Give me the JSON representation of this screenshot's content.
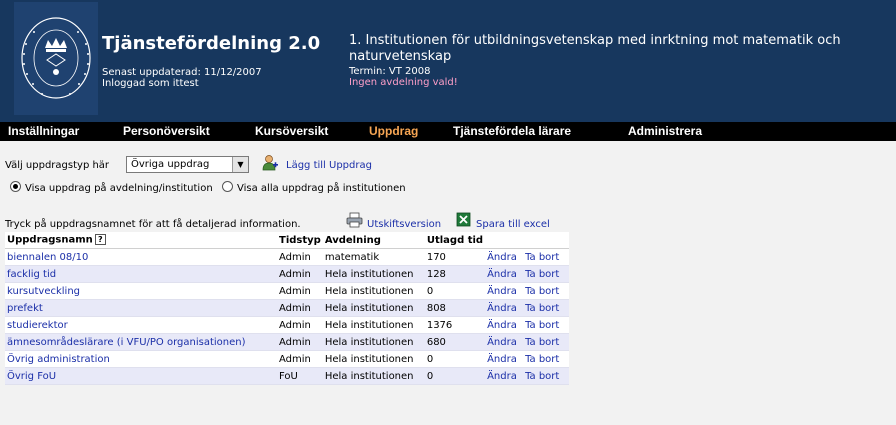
{
  "header": {
    "app_title": "Tjänstefördelning 2.0",
    "updated": "Senast uppdaterad: 11/12/2007",
    "logged_in": "Inloggad som ittest",
    "institution": "1. Institutionen för utbildningsvetenskap med inrktning mot matematik och naturvetenskap",
    "term": "Termin: VT 2008",
    "no_department": "Ingen avdelning vald!",
    "seal_text": "UNIVERSITET STOCKHOLMS"
  },
  "nav": {
    "items": [
      {
        "label": "Inställningar"
      },
      {
        "label": "Personöversikt"
      },
      {
        "label": "Kursöversikt"
      },
      {
        "label": "Uppdrag"
      },
      {
        "label": "Tjänstefördela lärare"
      },
      {
        "label": "Administrera"
      }
    ],
    "active": "Uppdrag",
    "active_color": "#f7a654"
  },
  "controls": {
    "type_label": "Välj uppdragstyp här",
    "type_selected": "Övriga uppdrag",
    "add_label": "Lägg till Uppdrag",
    "radio_dept": "Visa uppdrag på avdelning/institution",
    "radio_all": "Visa alla uppdrag på institutionen",
    "radio_selected": "dept"
  },
  "info": {
    "text": "Tryck på uppdragsnamnet för att få detaljerad information.",
    "print_label": "Utskiftsversion",
    "excel_label": "Spara till excel"
  },
  "table": {
    "headers": [
      "Uppdragsnamn",
      "Tidstyp",
      "Avdelning",
      "Utlagd tid",
      "",
      ""
    ],
    "help_glyph": "?",
    "edit_label": "Ändra",
    "delete_label": "Ta bort",
    "rows": [
      {
        "name": "biennalen 08/10",
        "type": "Admin",
        "dept": "matematik",
        "time": "170"
      },
      {
        "name": "facklig tid",
        "type": "Admin",
        "dept": "Hela institutionen",
        "time": "128"
      },
      {
        "name": "kursutveckling",
        "type": "Admin",
        "dept": "Hela institutionen",
        "time": "0"
      },
      {
        "name": "prefekt",
        "type": "Admin",
        "dept": "Hela institutionen",
        "time": "808"
      },
      {
        "name": "studierektor",
        "type": "Admin",
        "dept": "Hela institutionen",
        "time": "1376"
      },
      {
        "name": "ämnesområdeslärare (i VFU/PO organisationen)",
        "type": "Admin",
        "dept": "Hela institutionen",
        "time": "680"
      },
      {
        "name": "Övrig administration",
        "type": "Admin",
        "dept": "Hela institutionen",
        "time": "0"
      },
      {
        "name": "Övrig FoU",
        "type": "FoU",
        "dept": "Hela institutionen",
        "time": "0"
      }
    ]
  },
  "colors": {
    "header_bg": "#17375e",
    "link": "#1b2fa8",
    "alert": "#ff9fc9",
    "row_alt": "#e8e9f8"
  }
}
